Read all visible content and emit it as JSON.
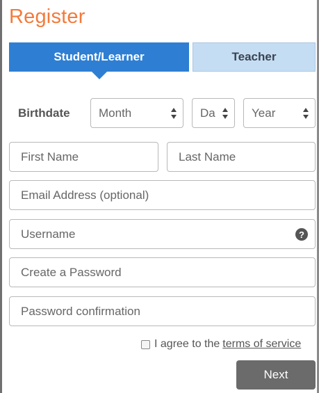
{
  "form": {
    "title": "Register",
    "tabs": {
      "student": "Student/Learner",
      "teacher": "Teacher"
    },
    "birthdate": {
      "label": "Birthdate",
      "month": "Month",
      "day": "Da",
      "year": "Year"
    },
    "fields": {
      "first_name": "First Name",
      "last_name": "Last Name",
      "email": "Email Address (optional)",
      "username": "Username",
      "password": "Create a Password",
      "password_confirm": "Password confirmation"
    },
    "help_glyph": "?",
    "agree_text": "I agree to the",
    "tos_link": "terms of service",
    "next_button": "Next"
  },
  "colors": {
    "title": "#f47a3a",
    "active_tab": "#2e7fd3",
    "inactive_tab": "#c5ddf3",
    "next_button": "#6b6b6b"
  }
}
